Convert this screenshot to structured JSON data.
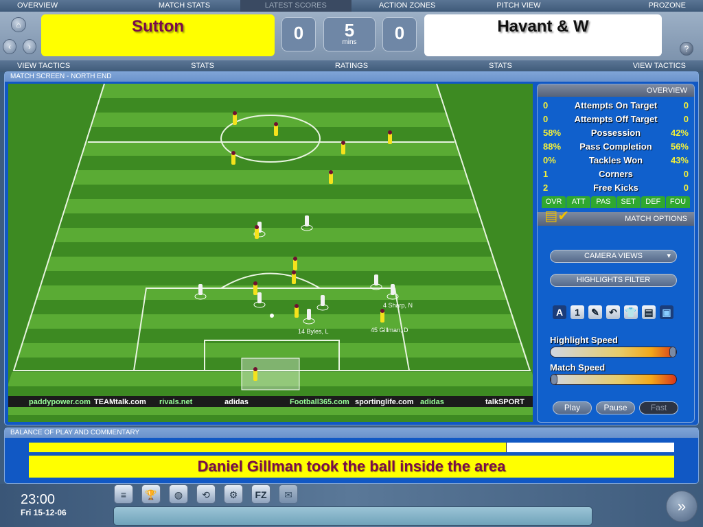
{
  "top_nav": [
    "OVERVIEW",
    "MATCH STATS",
    "LATEST SCORES",
    "ACTION ZONES",
    "PITCH VIEW",
    "PROZONE"
  ],
  "top_nav_active": "LATEST SCORES",
  "score": {
    "home_team": "Sutton",
    "away_team": "Havant & W",
    "home_goals": "0",
    "away_goals": "0",
    "minutes": "5",
    "minutes_label": "mins",
    "home_color": "#ffff00",
    "home_text_color": "#7a0a4a",
    "away_color": "#ffffff"
  },
  "sub_nav": [
    "VIEW TACTICS",
    "STATS",
    "RATINGS",
    "STATS",
    "VIEW TACTICS"
  ],
  "match_screen": {
    "title": "MATCH SCREEN - NORTH END",
    "player_labels": [
      "4 Sharp, N",
      "14 Byles, L",
      "45 Gillman, D"
    ],
    "ad_boards": [
      "paddypower.com",
      "TEAMtalk.com",
      "rivals.net",
      "adidas",
      "Football365.com",
      "sportinglife.com",
      "adidas",
      "talkSPORT"
    ]
  },
  "overview": {
    "title": "OVERVIEW",
    "stats": [
      {
        "home": "0",
        "label": "Attempts On Target",
        "away": "0"
      },
      {
        "home": "0",
        "label": "Attempts Off Target",
        "away": "0"
      },
      {
        "home": "58%",
        "label": "Possession",
        "away": "42%"
      },
      {
        "home": "88%",
        "label": "Pass Completion",
        "away": "56%"
      },
      {
        "home": "0%",
        "label": "Tackles Won",
        "away": "43%"
      },
      {
        "home": "1",
        "label": "Corners",
        "away": "0"
      },
      {
        "home": "2",
        "label": "Free Kicks",
        "away": "0"
      }
    ],
    "tabs": [
      "OVR",
      "ATT",
      "PAS",
      "SET",
      "DEF",
      "FOU"
    ]
  },
  "match_options": {
    "title": "MATCH OPTIONS",
    "camera_views": "CAMERA VIEWS",
    "highlights_filter": "HIGHLIGHTS FILTER",
    "tool_icons": [
      "A",
      "1"
    ],
    "highlight_speed_label": "Highlight Speed",
    "highlight_speed": 1.0,
    "match_speed_label": "Match Speed",
    "match_speed": 0.0,
    "play": "Play",
    "pause": "Pause",
    "fast": "Fast"
  },
  "commentary": {
    "title": "BALANCE OF PLAY AND COMMENTARY",
    "balance_home": 0.74,
    "text": "Daniel Gillman took the ball inside the area"
  },
  "footer": {
    "time": "23:00",
    "date": "Fri 15-12-06",
    "fz_icon": "FZ"
  }
}
